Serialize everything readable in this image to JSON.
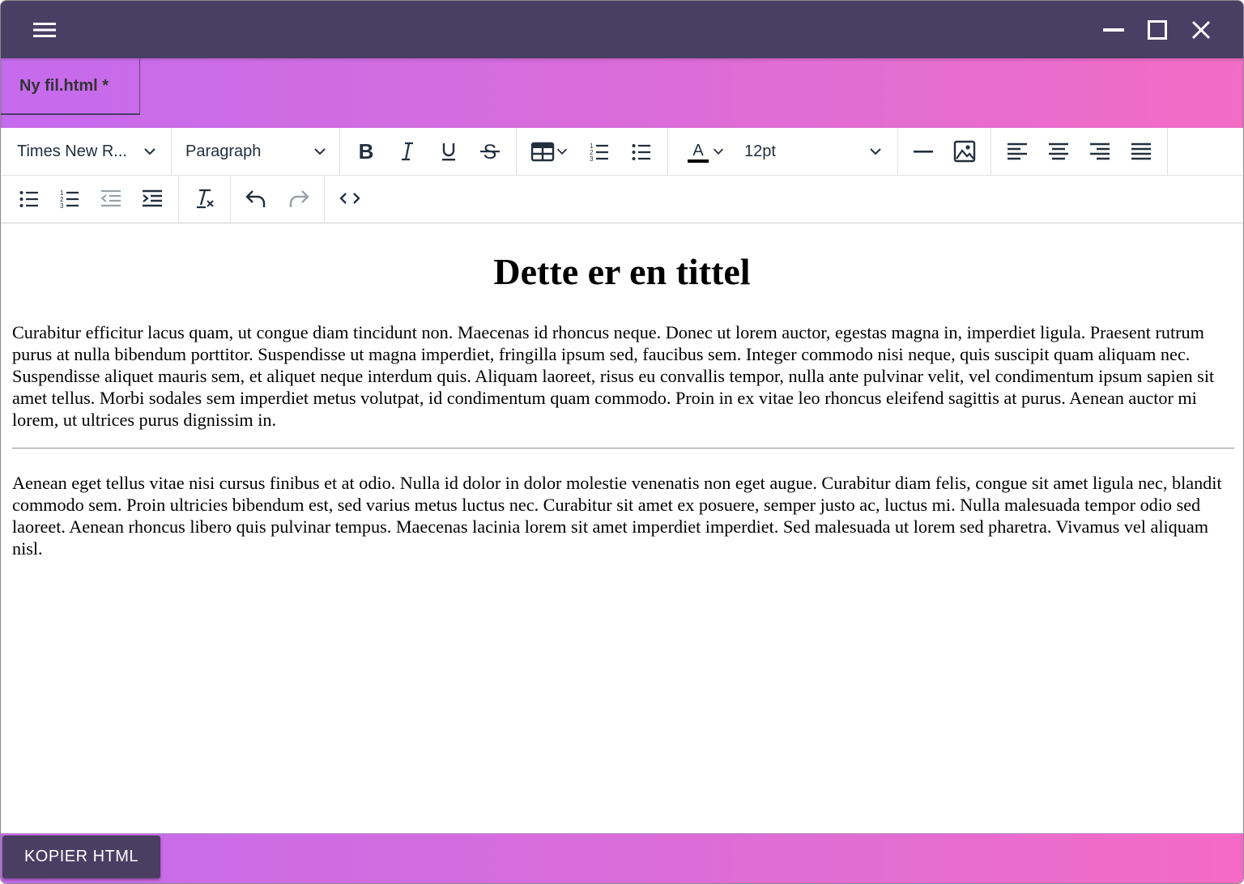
{
  "titlebar": {
    "menu_icon": "hamburger-icon",
    "minimize_icon": "minimize-icon",
    "maximize_icon": "maximize-icon",
    "close_icon": "close-icon"
  },
  "tabs": [
    {
      "label": "Ny fil.html *"
    }
  ],
  "toolbar": {
    "font_family": "Times New R...",
    "block_format": "Paragraph",
    "font_size": "12pt",
    "row1_icons": [
      "bold-icon",
      "italic-icon",
      "underline-icon",
      "strikethrough-icon",
      "table-icon",
      "numbered-list-icon",
      "bullet-list-icon",
      "text-color-icon",
      "horizontal-line-icon",
      "image-icon",
      "align-left-icon",
      "align-center-icon",
      "align-right-icon",
      "align-justify-icon"
    ],
    "row2_icons": [
      "bullet-list-icon",
      "numbered-list-icon",
      "outdent-icon",
      "indent-icon",
      "clear-formatting-icon",
      "undo-icon",
      "redo-icon",
      "source-code-icon"
    ],
    "text_color": "#000000"
  },
  "document": {
    "title": "Dette er en tittel",
    "paragraphs": [
      "Curabitur efficitur lacus quam, ut congue diam tincidunt non. Maecenas id rhoncus neque. Donec ut lorem auctor, egestas magna in, imperdiet ligula. Praesent rutrum purus at nulla bibendum porttitor. Suspendisse ut magna imperdiet, fringilla ipsum sed, faucibus sem. Integer commodo nisi neque, quis suscipit quam aliquam nec. Suspendisse aliquet mauris sem, et aliquet neque interdum quis. Aliquam laoreet, risus eu convallis tempor, nulla ante pulvinar velit, vel condimentum ipsum sapien sit amet tellus. Morbi sodales sem imperdiet metus volutpat, id condimentum quam commodo. Proin in ex vitae leo rhoncus eleifend sagittis at purus. Aenean auctor mi lorem, ut ultrices purus dignissim in.",
      "Aenean eget tellus vitae nisi cursus finibus et at odio. Nulla id dolor in dolor molestie venenatis non eget augue. Curabitur diam felis, congue sit amet ligula nec, blandit commodo sem. Proin ultricies bibendum est, sed varius metus luctus nec. Curabitur sit amet ex posuere, semper justo ac, luctus mi. Nulla malesuada tempor odio sed laoreet. Aenean rhoncus libero quis pulvinar tempus. Maecenas lacinia lorem sit amet imperdiet imperdiet. Sed malesuada ut lorem sed pharetra. Vivamus vel aliquam nisl."
    ]
  },
  "footer": {
    "copy_button": "KOPIER HTML"
  },
  "colors": {
    "titlebar": "#483f64",
    "gradient_start": "#c56bed",
    "gradient_end": "#f36cc5",
    "button": "#4b3e63"
  }
}
